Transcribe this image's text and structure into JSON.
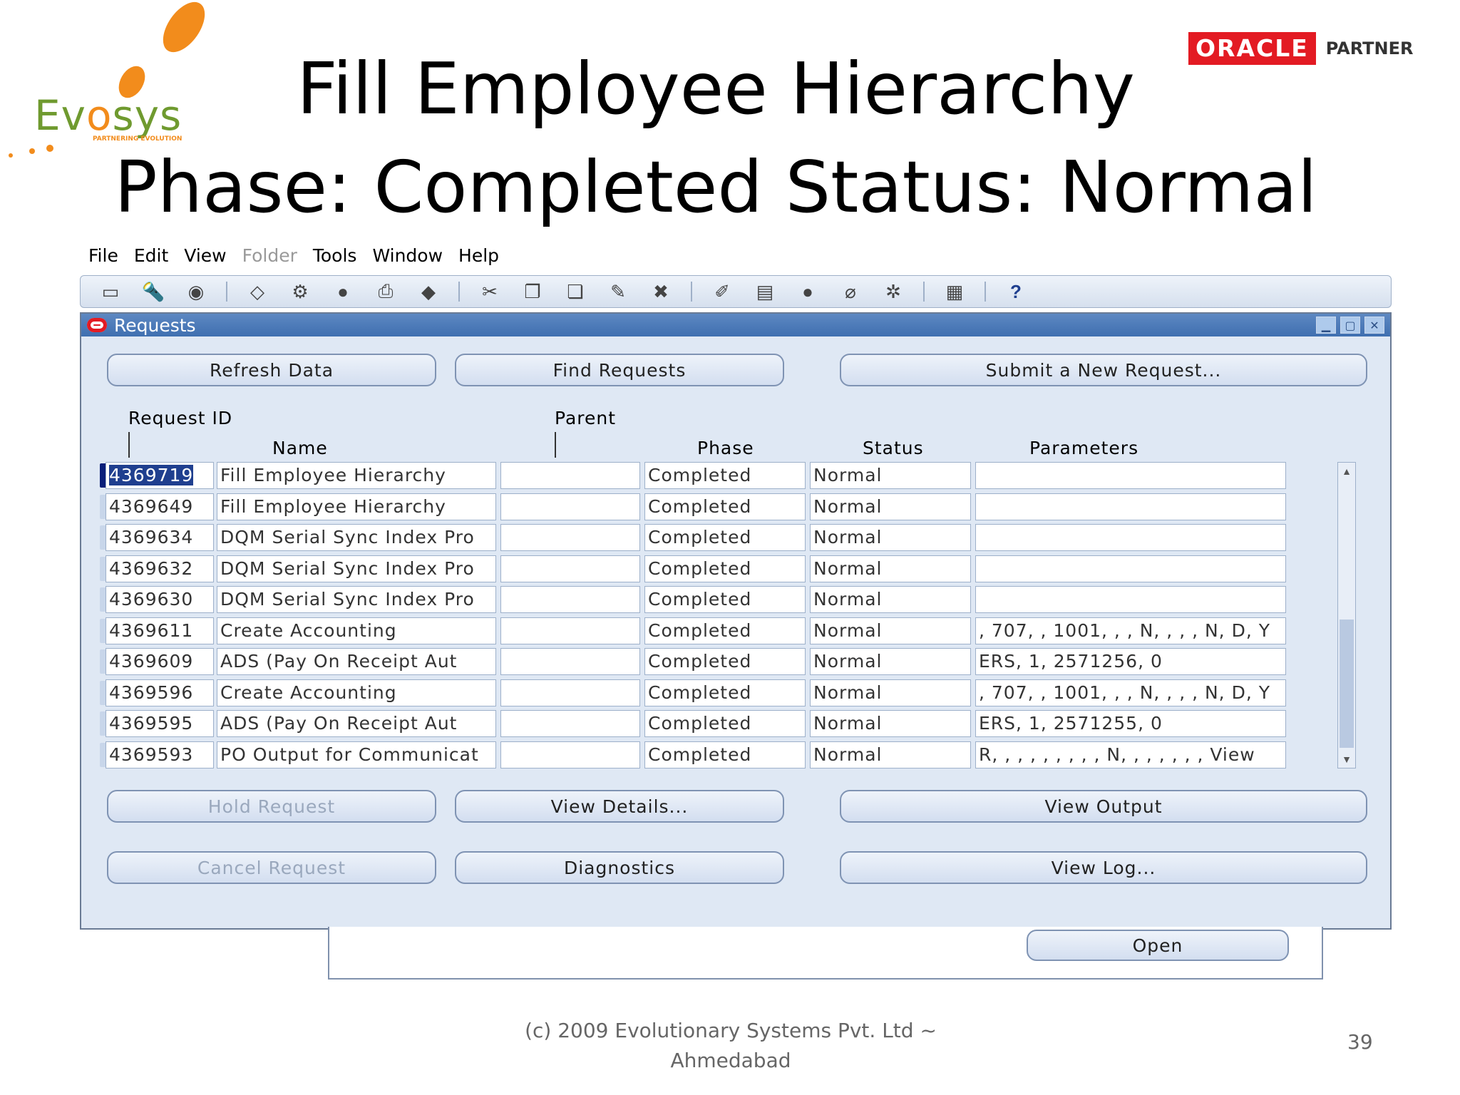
{
  "slide": {
    "title_line1": "Fill Employee Hierarchy",
    "title_line2": "Phase: Completed  Status: Normal",
    "footer_line1": "(c) 2009 Evolutionary Systems Pvt. Ltd ~",
    "footer_line2": "Ahmedabad",
    "page_number": "39",
    "logo_text": "Evosys",
    "logo_tagline": "PARTNERING EVOLUTION",
    "oracle_logo": "ORACLE",
    "oracle_partner": "PARTNER",
    "colors": {
      "oracle_red": "#e31b23",
      "evosys_green": "#6f9a2f",
      "evosys_orange": "#f28c1c"
    }
  },
  "menu": [
    "File",
    "Edit",
    "View",
    "Folder",
    "Tools",
    "Window",
    "Help"
  ],
  "toolbar_icons": [
    "new-icon",
    "find-icon",
    "navigator-icon",
    "save-icon",
    "next-step-icon",
    "print-preview-icon",
    "print-icon",
    "close-form-icon",
    "cut-icon",
    "copy-icon",
    "paste-icon",
    "new-record-icon",
    "delete-record-icon",
    "edit-field-icon",
    "zoom-icon",
    "translations-icon",
    "attachments-icon",
    "folder-tools-icon",
    "window-icon",
    "help-icon"
  ],
  "window": {
    "title": "Requests",
    "buttons": {
      "refresh": "Refresh Data",
      "find": "Find Requests",
      "submit": "Submit a New Request...",
      "hold": "Hold Request",
      "view_details": "View Details...",
      "view_output": "View Output",
      "cancel": "Cancel Request",
      "diagnostics": "Diagnostics",
      "view_log": "View Log...",
      "open": "Open"
    },
    "columns": {
      "request_id": "Request ID",
      "parent": "Parent",
      "name": "Name",
      "phase": "Phase",
      "status": "Status",
      "parameters": "Parameters"
    },
    "rows": [
      {
        "id": "4369719",
        "name": "Fill Employee Hierarchy",
        "parent": "",
        "phase": "Completed",
        "status": "Normal",
        "parameters": ""
      },
      {
        "id": "4369649",
        "name": "Fill Employee Hierarchy",
        "parent": "",
        "phase": "Completed",
        "status": "Normal",
        "parameters": ""
      },
      {
        "id": "4369634",
        "name": "DQM Serial Sync Index Pro",
        "parent": "",
        "phase": "Completed",
        "status": "Normal",
        "parameters": ""
      },
      {
        "id": "4369632",
        "name": "DQM Serial Sync Index Pro",
        "parent": "",
        "phase": "Completed",
        "status": "Normal",
        "parameters": ""
      },
      {
        "id": "4369630",
        "name": "DQM Serial Sync Index Pro",
        "parent": "",
        "phase": "Completed",
        "status": "Normal",
        "parameters": ""
      },
      {
        "id": "4369611",
        "name": "Create Accounting",
        "parent": "",
        "phase": "Completed",
        "status": "Normal",
        "parameters": ", 707, , 1001, , , N, , , , N, D, Y"
      },
      {
        "id": "4369609",
        "name": "ADS  (Pay On Receipt Aut",
        "parent": "",
        "phase": "Completed",
        "status": "Normal",
        "parameters": "ERS, 1, 2571256, 0"
      },
      {
        "id": "4369596",
        "name": "Create Accounting",
        "parent": "",
        "phase": "Completed",
        "status": "Normal",
        "parameters": ", 707, , 1001, , , N, , , , N, D, Y"
      },
      {
        "id": "4369595",
        "name": "ADS  (Pay On Receipt Aut",
        "parent": "",
        "phase": "Completed",
        "status": "Normal",
        "parameters": "ERS, 1, 2571255, 0"
      },
      {
        "id": "4369593",
        "name": "PO Output for Communicat",
        "parent": "",
        "phase": "Completed",
        "status": "Normal",
        "parameters": "R, , , , , , , , , N, , , , , , , View"
      }
    ]
  }
}
